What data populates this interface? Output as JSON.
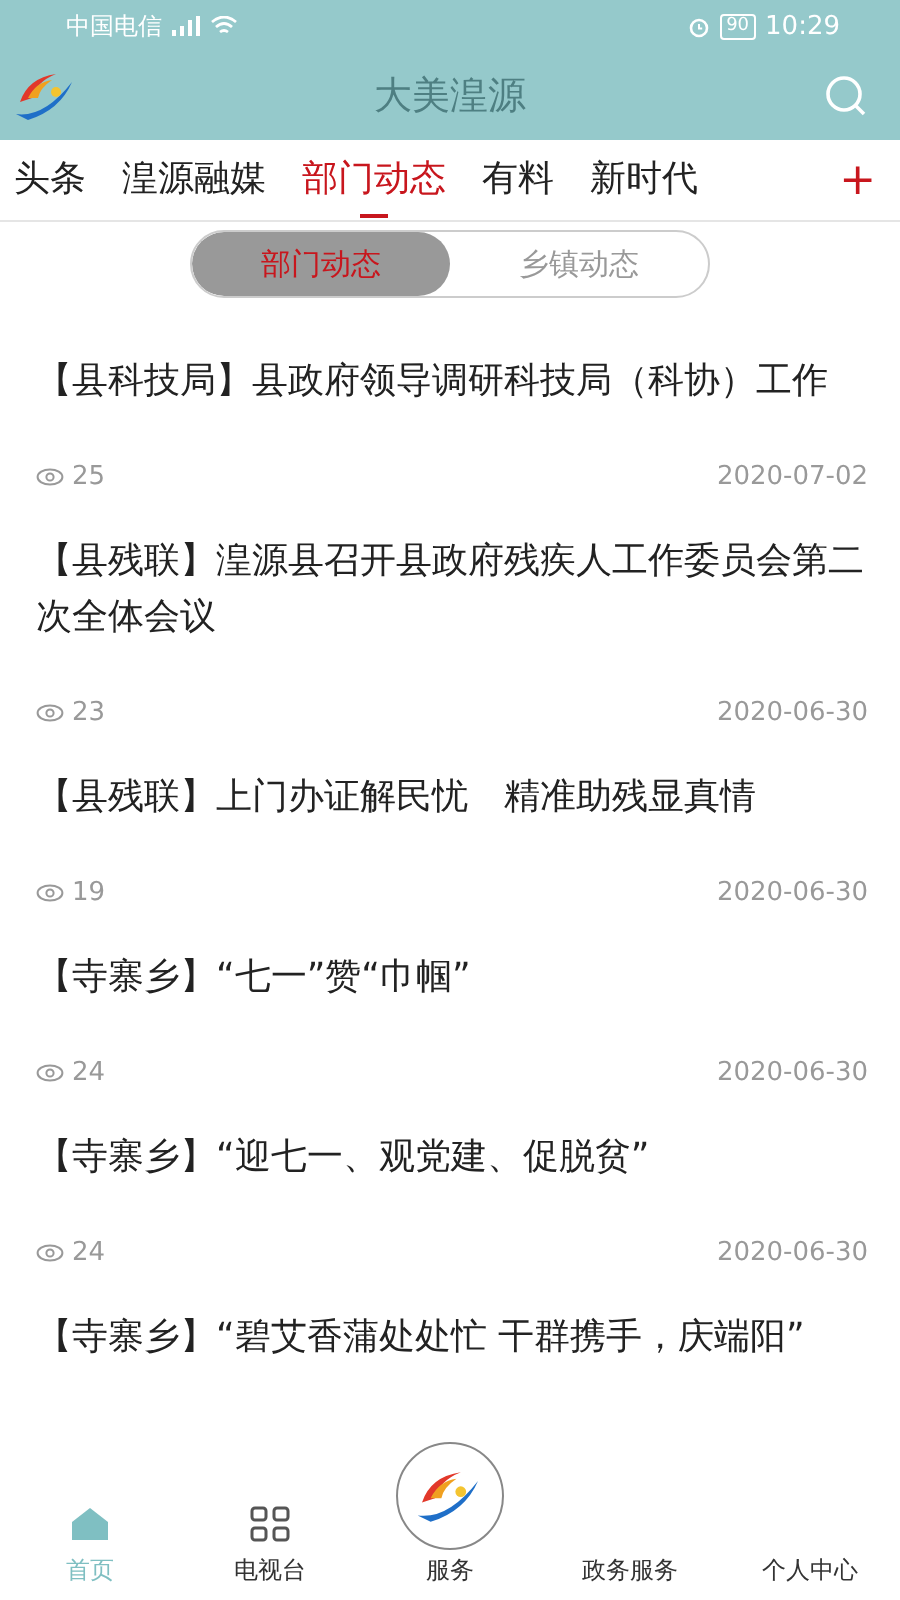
{
  "status_bar": {
    "carrier": "中国电信",
    "battery": "90",
    "time": "10:29"
  },
  "header": {
    "title": "大美湟源"
  },
  "tabs": [
    {
      "label": "头条",
      "selected": false
    },
    {
      "label": "湟源融媒",
      "selected": false
    },
    {
      "label": "部门动态",
      "selected": true
    },
    {
      "label": "有料",
      "selected": false
    },
    {
      "label": "新时代",
      "selected": false
    }
  ],
  "add_tab": "+",
  "segments": [
    {
      "label": "部门动态",
      "selected": true
    },
    {
      "label": "乡镇动态",
      "selected": false
    }
  ],
  "articles": [
    {
      "title": "【县科技局】县政府领导调研科技局（科协）工作",
      "views": "25",
      "date": "2020-07-02"
    },
    {
      "title": "【县残联】湟源县召开县政府残疾人工作委员会第二次全体会议",
      "views": "23",
      "date": "2020-06-30"
    },
    {
      "title": "【县残联】上门办证解民忧　精准助残显真情",
      "views": "19",
      "date": "2020-06-30"
    },
    {
      "title": "【寺寨乡】“七一”赞“巾帼”",
      "views": "24",
      "date": "2020-06-30"
    },
    {
      "title": "【寺寨乡】“迎七一、观党建、促脱贫”",
      "views": "24",
      "date": "2020-06-30"
    },
    {
      "title": "【寺寨乡】“碧艾香蒲处处忙 干群携手，庆端阳”"
    }
  ],
  "bottom_nav": [
    {
      "label": "首页",
      "kind": "home",
      "selected": true
    },
    {
      "label": "电视台",
      "kind": "grid",
      "selected": false
    },
    {
      "label": "服务",
      "kind": "logo",
      "selected": false
    },
    {
      "label": "政务服务",
      "kind": "none",
      "selected": false
    },
    {
      "label": "个人中心",
      "kind": "none",
      "selected": false
    }
  ]
}
